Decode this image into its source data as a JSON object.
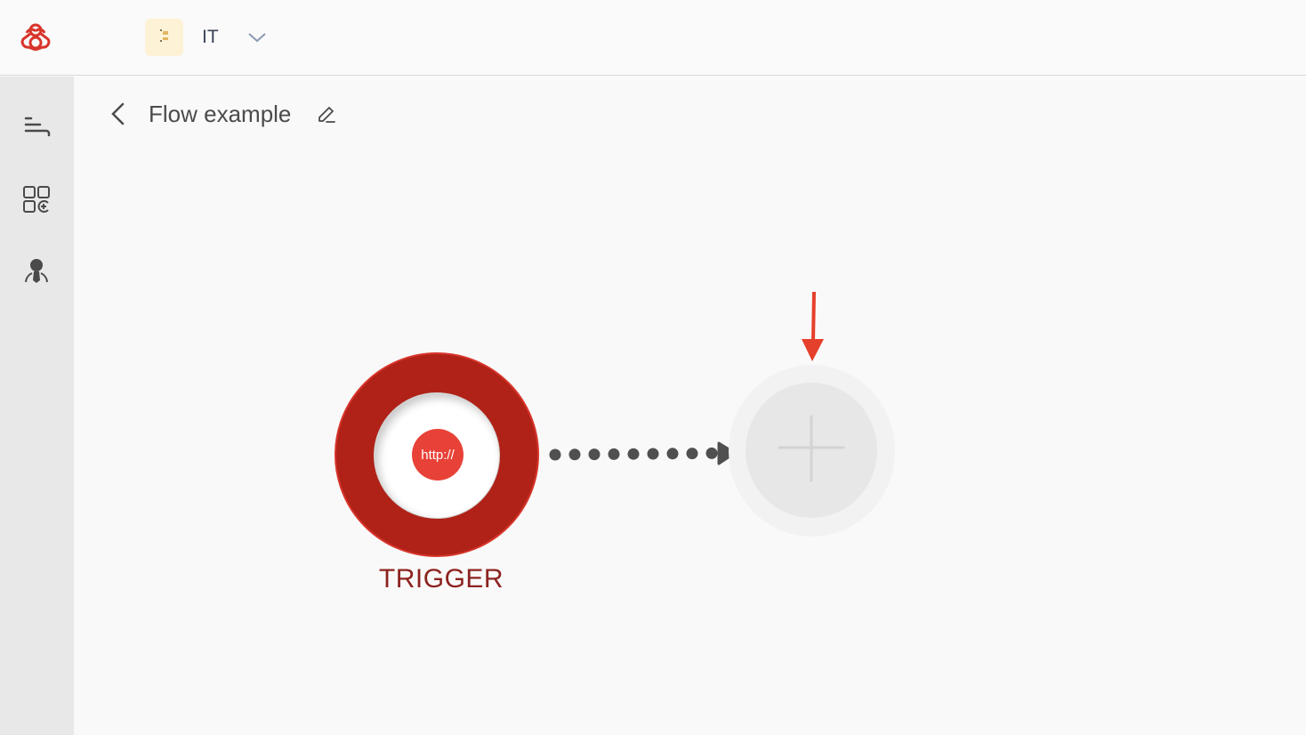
{
  "topbar": {
    "logo": "brand-logo-icon",
    "workspace": {
      "icon": "hourglass-icon",
      "name": "IT",
      "dropdown_icon": "chevron-down-icon"
    }
  },
  "sidebar": {
    "items": [
      {
        "name": "flows",
        "icon": "flows-list-icon"
      },
      {
        "name": "integrations",
        "icon": "apps-add-icon"
      },
      {
        "name": "users",
        "icon": "user-agent-icon"
      }
    ]
  },
  "header": {
    "back_icon": "chevron-left-icon",
    "title": "Flow example",
    "edit_icon": "pencil-icon"
  },
  "flow": {
    "trigger": {
      "icon_text": "http://",
      "label": "TRIGGER"
    },
    "connector_icon": "dotted-arrow-icon",
    "add_step_icon": "plus-icon",
    "annotation_icon": "red-down-arrow-icon"
  },
  "colors": {
    "trigger_ring": "#b02218",
    "trigger_core": "#e84238",
    "trigger_label": "#8c2320",
    "annotation": "#e5402b"
  }
}
